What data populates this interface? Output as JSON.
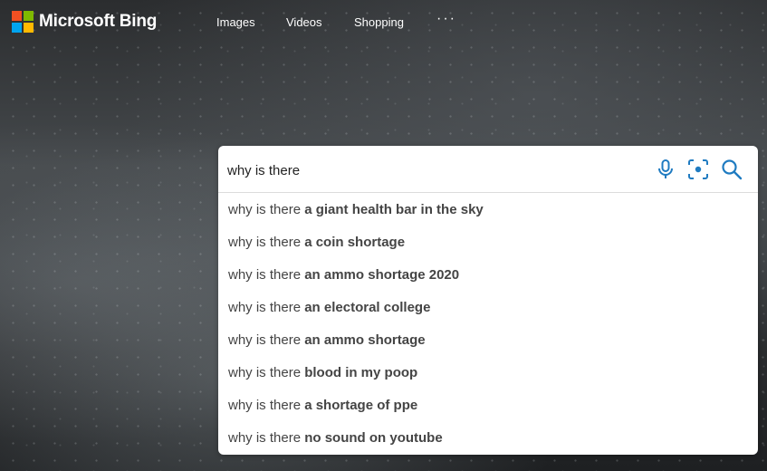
{
  "brand": {
    "name": "Microsoft Bing",
    "logo_colors": [
      "#f25022",
      "#7fba00",
      "#00a4ef",
      "#ffb900"
    ]
  },
  "nav": {
    "items": [
      "Images",
      "Videos",
      "Shopping"
    ],
    "more_icon": "ellipsis-icon",
    "more_label": "···"
  },
  "search": {
    "value": "why is there",
    "icons": [
      "microphone-icon",
      "visual-search-icon",
      "search-icon"
    ],
    "accent_color": "#1f7bc1"
  },
  "suggestions": [
    {
      "prefix": "why is there ",
      "completion": "a giant health bar in the sky"
    },
    {
      "prefix": "why is there ",
      "completion": "a coin shortage"
    },
    {
      "prefix": "why is there ",
      "completion": "an ammo shortage 2020"
    },
    {
      "prefix": "why is there ",
      "completion": "an electoral college"
    },
    {
      "prefix": "why is there ",
      "completion": "an ammo shortage"
    },
    {
      "prefix": "why is there ",
      "completion": "blood in my poop"
    },
    {
      "prefix": "why is there ",
      "completion": "a shortage of ppe"
    },
    {
      "prefix": "why is there ",
      "completion": "no sound on youtube"
    }
  ]
}
